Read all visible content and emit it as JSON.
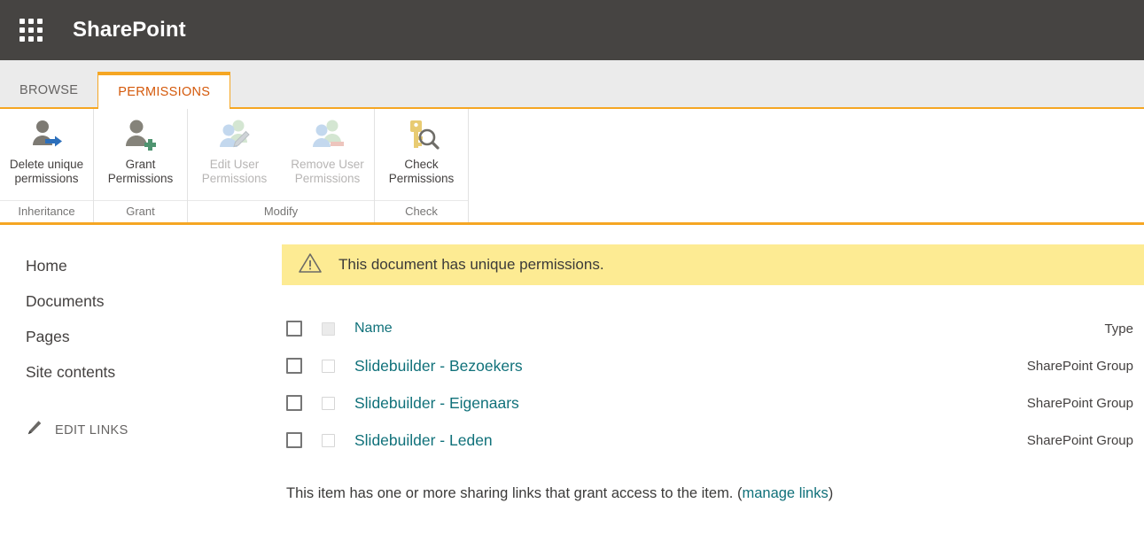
{
  "suite": {
    "app_launcher_icon": "waffle-grid-icon",
    "title": "SharePoint"
  },
  "tabs": [
    {
      "label": "BROWSE",
      "active": false
    },
    {
      "label": "PERMISSIONS",
      "active": true
    }
  ],
  "ribbon": {
    "groups": [
      {
        "title": "Inheritance",
        "buttons": [
          {
            "label": "Delete unique\npermissions",
            "icon": "person-arrow-icon",
            "disabled": false
          }
        ]
      },
      {
        "title": "Grant",
        "buttons": [
          {
            "label": "Grant\nPermissions",
            "icon": "person-plus-icon",
            "disabled": false
          }
        ]
      },
      {
        "title": "Modify",
        "buttons": [
          {
            "label": "Edit User\nPermissions",
            "icon": "people-pencil-icon",
            "disabled": true
          },
          {
            "label": "Remove User\nPermissions",
            "icon": "people-minus-icon",
            "disabled": true
          }
        ]
      },
      {
        "title": "Check",
        "buttons": [
          {
            "label": "Check\nPermissions",
            "icon": "key-magnifier-icon",
            "disabled": false
          }
        ]
      }
    ]
  },
  "sidebar": {
    "items": [
      {
        "label": "Home"
      },
      {
        "label": "Documents"
      },
      {
        "label": "Pages"
      },
      {
        "label": "Site contents"
      }
    ],
    "edit_links": {
      "label": "EDIT LINKS",
      "icon": "pencil-icon"
    }
  },
  "banner": {
    "icon": "warning-triangle-icon",
    "message": "This document has unique permissions."
  },
  "permissions_table": {
    "header": {
      "name": "Name",
      "type": "Type"
    },
    "rows": [
      {
        "name": "Slidebuilder - Bezoekers",
        "type": "SharePoint Group"
      },
      {
        "name": "Slidebuilder - Eigenaars",
        "type": "SharePoint Group"
      },
      {
        "name": "Slidebuilder - Leden",
        "type": "SharePoint Group"
      }
    ]
  },
  "sharing_note": {
    "text_before": "This item has one or more sharing links that grant access to the item. (",
    "link_label": "manage links",
    "text_after": ")"
  },
  "colors": {
    "suite_bar": "#464442",
    "accent_orange": "#f5a623",
    "active_tab_text": "#d4590b",
    "link_teal": "#10717a",
    "banner_yellow": "#fdeb93",
    "tab_strip": "#ebebeb"
  }
}
